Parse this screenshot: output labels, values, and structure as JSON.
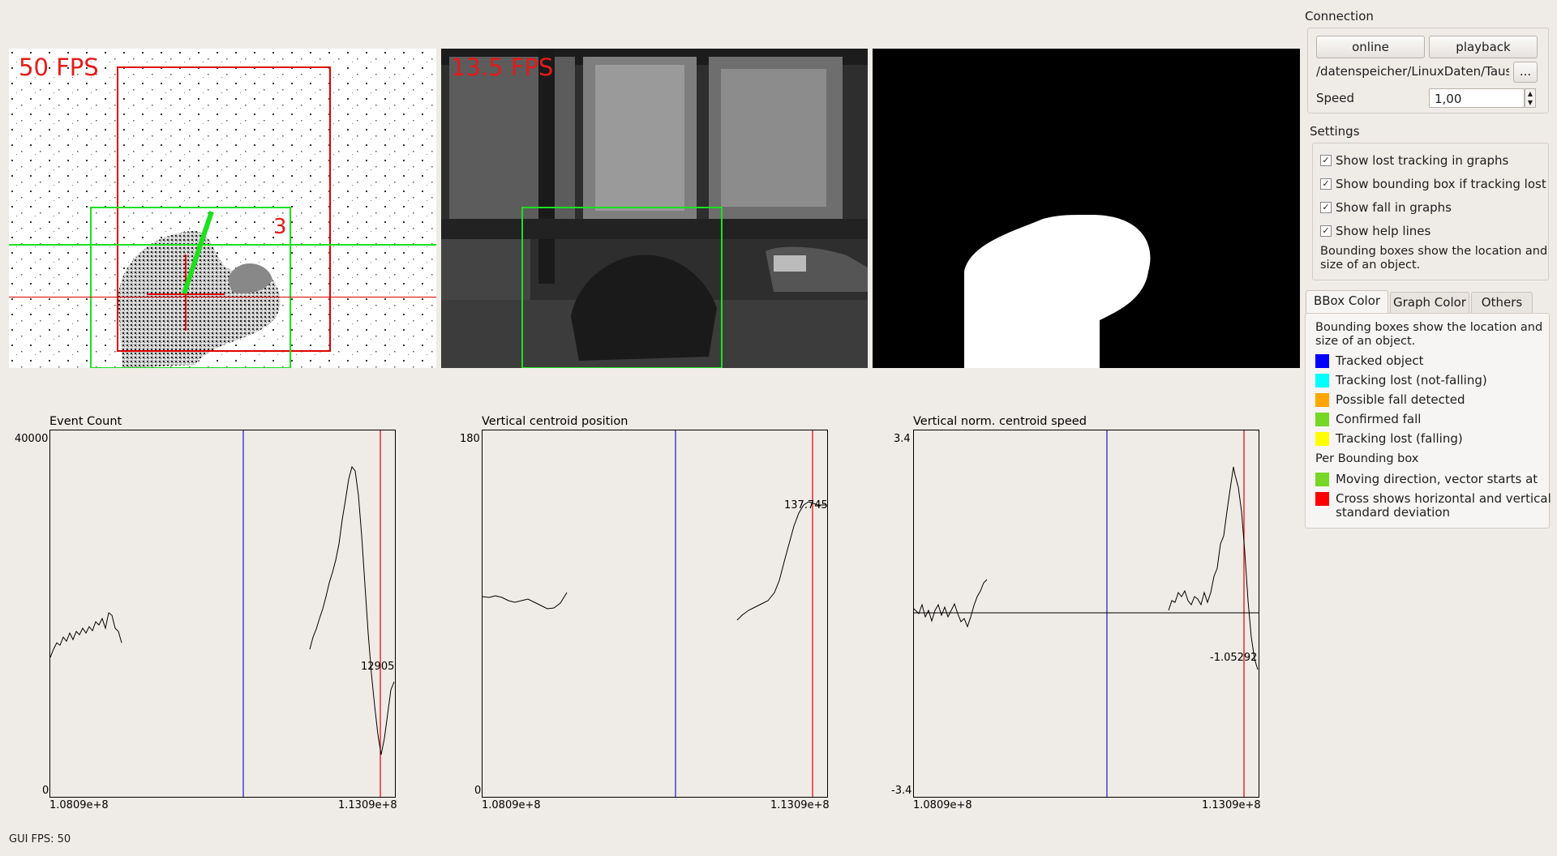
{
  "views": {
    "event_fps": "50 FPS",
    "frame_fps": "13.5 FPS",
    "object_count": "3"
  },
  "graphs": [
    {
      "title": "Event Count",
      "ymax": "40000",
      "ymin": "0",
      "xmin": "1.0809e+8",
      "xmax": "1.1309e+8",
      "value": "12905"
    },
    {
      "title": "Vertical centroid position",
      "ymax": "180",
      "ymin": "0",
      "xmin": "1.0809e+8",
      "xmax": "1.1309e+8",
      "value": "137.745"
    },
    {
      "title": "Vertical norm. centroid speed",
      "ymax": "3.4",
      "ymin": "-3.4",
      "xmin": "1.0809e+8",
      "xmax": "1.1309e+8",
      "value": "-1.05292"
    }
  ],
  "status": {
    "gui_fps": "GUI FPS: 50"
  },
  "connection": {
    "title": "Connection",
    "online_label": "online",
    "playback_label": "playback",
    "path": "/datenspeicher/LinuxDaten/Tausch",
    "browse_label": "...",
    "speed_label": "Speed",
    "speed_value": "1,00"
  },
  "settings": {
    "title": "Settings",
    "options": [
      {
        "label": "Show lost tracking in graphs",
        "checked": true
      },
      {
        "label": "Show bounding box if tracking lost",
        "checked": true
      },
      {
        "label": "Show fall in graphs",
        "checked": true
      },
      {
        "label": "Show help lines",
        "checked": true
      }
    ],
    "help_line1": "Bounding boxes show the location and",
    "help_line2": "size of an object."
  },
  "tabs": [
    "BBox Color",
    "Graph Color",
    "Others"
  ],
  "bbox_color": {
    "intro1": "Bounding boxes show the location and",
    "intro2": "size of an object.",
    "items": [
      {
        "label": "Tracked object",
        "color": "#0000ff"
      },
      {
        "label": "Tracking lost (not-falling)",
        "color": "#00ffff"
      },
      {
        "label": "Possible fall detected",
        "color": "#ffa500"
      },
      {
        "label": "Confirmed fall",
        "color": "#76d726"
      },
      {
        "label": "Tracking lost (falling)",
        "color": "#ffff00"
      }
    ],
    "per_box_title": "Per Bounding box",
    "per_box_items": [
      {
        "label": "Moving direction, vector starts at cen",
        "color": "#76d726"
      },
      {
        "label1": "Cross shows horizontal and vertical",
        "label2": "standard deviation",
        "color": "#ff0000"
      }
    ]
  },
  "colors": {
    "accent_red": "#e31b1b",
    "bbox_green": "#1ee01e",
    "marker_blue": "#0000ff",
    "marker_red": "#e00000"
  }
}
